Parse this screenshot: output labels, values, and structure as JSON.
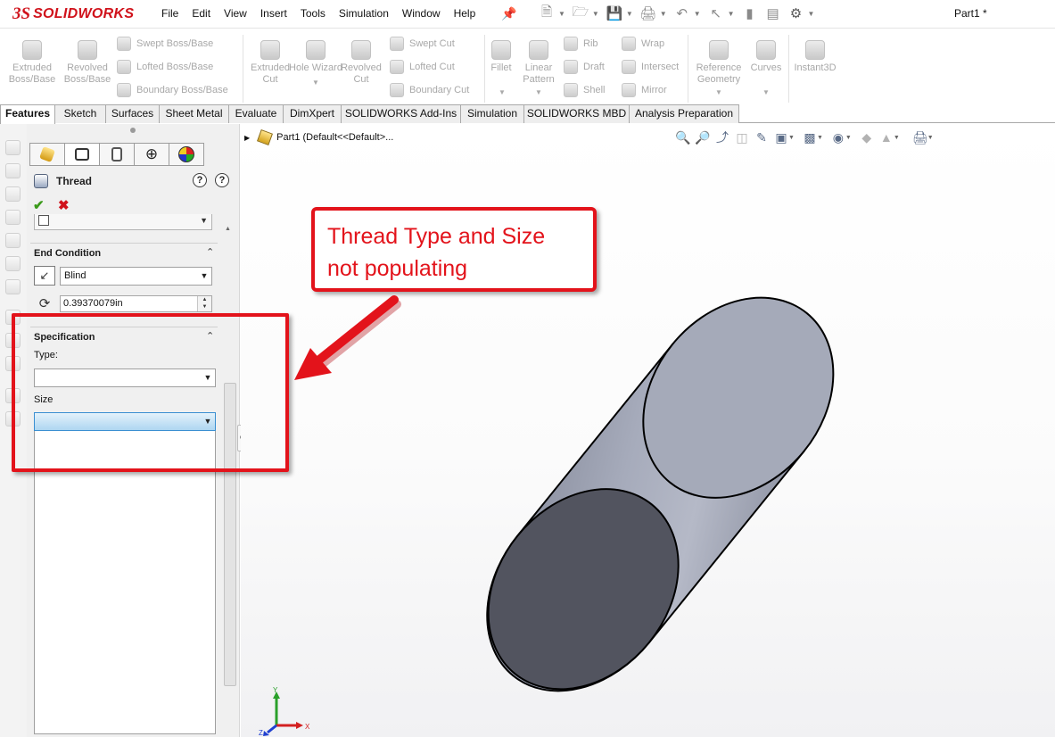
{
  "app": {
    "brand": "SOLIDWORKS",
    "brand_prefix": "3S",
    "document_title": "Part1 *"
  },
  "menu": [
    "File",
    "Edit",
    "View",
    "Insert",
    "Tools",
    "Simulation",
    "Window",
    "Help"
  ],
  "ribbon": {
    "extruded_boss": "Extruded Boss/Base",
    "revolved_boss": "Revolved Boss/Base",
    "swept_boss": "Swept Boss/Base",
    "lofted_boss": "Lofted Boss/Base",
    "boundary_boss": "Boundary Boss/Base",
    "extruded_cut": "Extruded Cut",
    "hole_wizard": "Hole Wizard",
    "revolved_cut": "Revolved Cut",
    "swept_cut": "Swept Cut",
    "lofted_cut": "Lofted Cut",
    "boundary_cut": "Boundary Cut",
    "fillet": "Fillet",
    "linear_pattern": "Linear Pattern",
    "rib": "Rib",
    "draft": "Draft",
    "shell": "Shell",
    "wrap": "Wrap",
    "intersect": "Intersect",
    "mirror": "Mirror",
    "reference_geometry": "Reference Geometry",
    "curves": "Curves",
    "instant3d": "Instant3D"
  },
  "tabs": [
    "Features",
    "Sketch",
    "Surfaces",
    "Sheet Metal",
    "Evaluate",
    "DimXpert",
    "SOLIDWORKS Add-Ins",
    "Simulation",
    "SOLIDWORKS MBD",
    "Analysis Preparation"
  ],
  "property_manager": {
    "title": "Thread",
    "end_condition": {
      "heading": "End Condition",
      "selected": "Blind",
      "depth": "0.39370079in"
    },
    "specification": {
      "heading": "Specification",
      "type_label": "Type:",
      "type_value": "",
      "size_label": "Size",
      "size_value": ""
    }
  },
  "viewport": {
    "tree_label": "Part1  (Default<<Default>..."
  },
  "triad": {
    "x": "X",
    "y": "Y",
    "z": "Z"
  },
  "annotation": {
    "callout_line1": "Thread Type and Size",
    "callout_line2": "not populating"
  },
  "colors": {
    "brand_red": "#d0121b",
    "annotation_red": "#e3131b",
    "cylinder_side": "#9aa0b2",
    "cylinder_cap": "#52545f",
    "focus_blue": "#aed6f1"
  }
}
